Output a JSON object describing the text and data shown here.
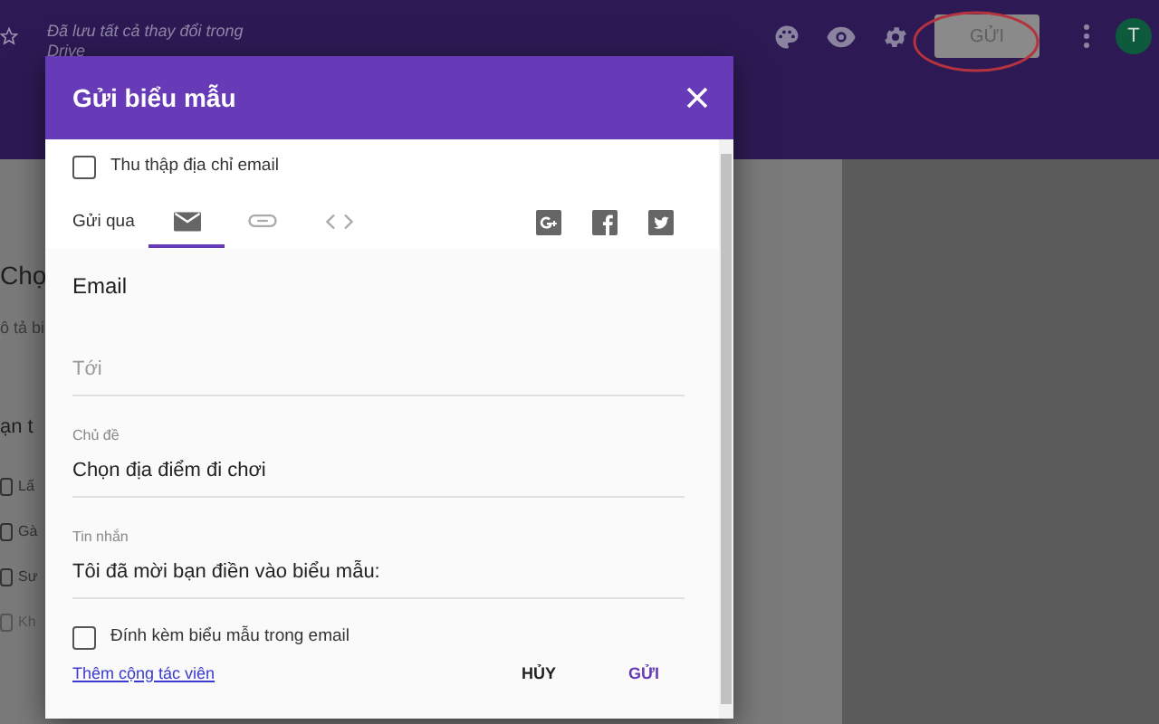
{
  "top_bar": {
    "save_status": "Đã lưu tất cả thay đổi trong Drive",
    "send_button": "GỬI",
    "avatar": "T"
  },
  "form_page": {
    "title": "Chọ",
    "description": "ô tả bi",
    "question": "ạn t",
    "options": [
      {
        "label": "Lấ",
        "kind": "option",
        "checked": false
      },
      {
        "label": "Gà",
        "kind": "option",
        "checked": false
      },
      {
        "label": "Sư",
        "kind": "option",
        "checked": false
      },
      {
        "label": "Kh",
        "kind": "other",
        "checked": false
      }
    ]
  },
  "dialog": {
    "title": "Gửi biểu mẫu",
    "collect_email": {
      "label": "Thu thập địa chỉ email",
      "checked": false
    },
    "send_via": {
      "label": "Gửi qua",
      "tabs": [
        {
          "kind": "email",
          "selected": true
        },
        {
          "kind": "link",
          "selected": false
        },
        {
          "kind": "embed",
          "selected": false
        }
      ]
    },
    "share": [
      {
        "kind": "google-plus"
      },
      {
        "kind": "facebook"
      },
      {
        "kind": "twitter"
      }
    ],
    "section_title": "Email",
    "fields": [
      {
        "placeholder": "Tới"
      },
      {
        "label": "Chủ đề",
        "value": "Chọn địa điểm đi chơi"
      },
      {
        "label": "Tin nhắn",
        "value": "Tôi đã mời bạn điền vào biểu mẫu:"
      }
    ],
    "attach_form": {
      "label": "Đính kèm biểu mẫu trong email",
      "checked": false
    },
    "add_collaborators": "Thêm cộng tác viên",
    "buttons": [
      {
        "kind": "cancel",
        "label": "HỦY"
      },
      {
        "kind": "send",
        "label": "GỬI"
      }
    ]
  }
}
